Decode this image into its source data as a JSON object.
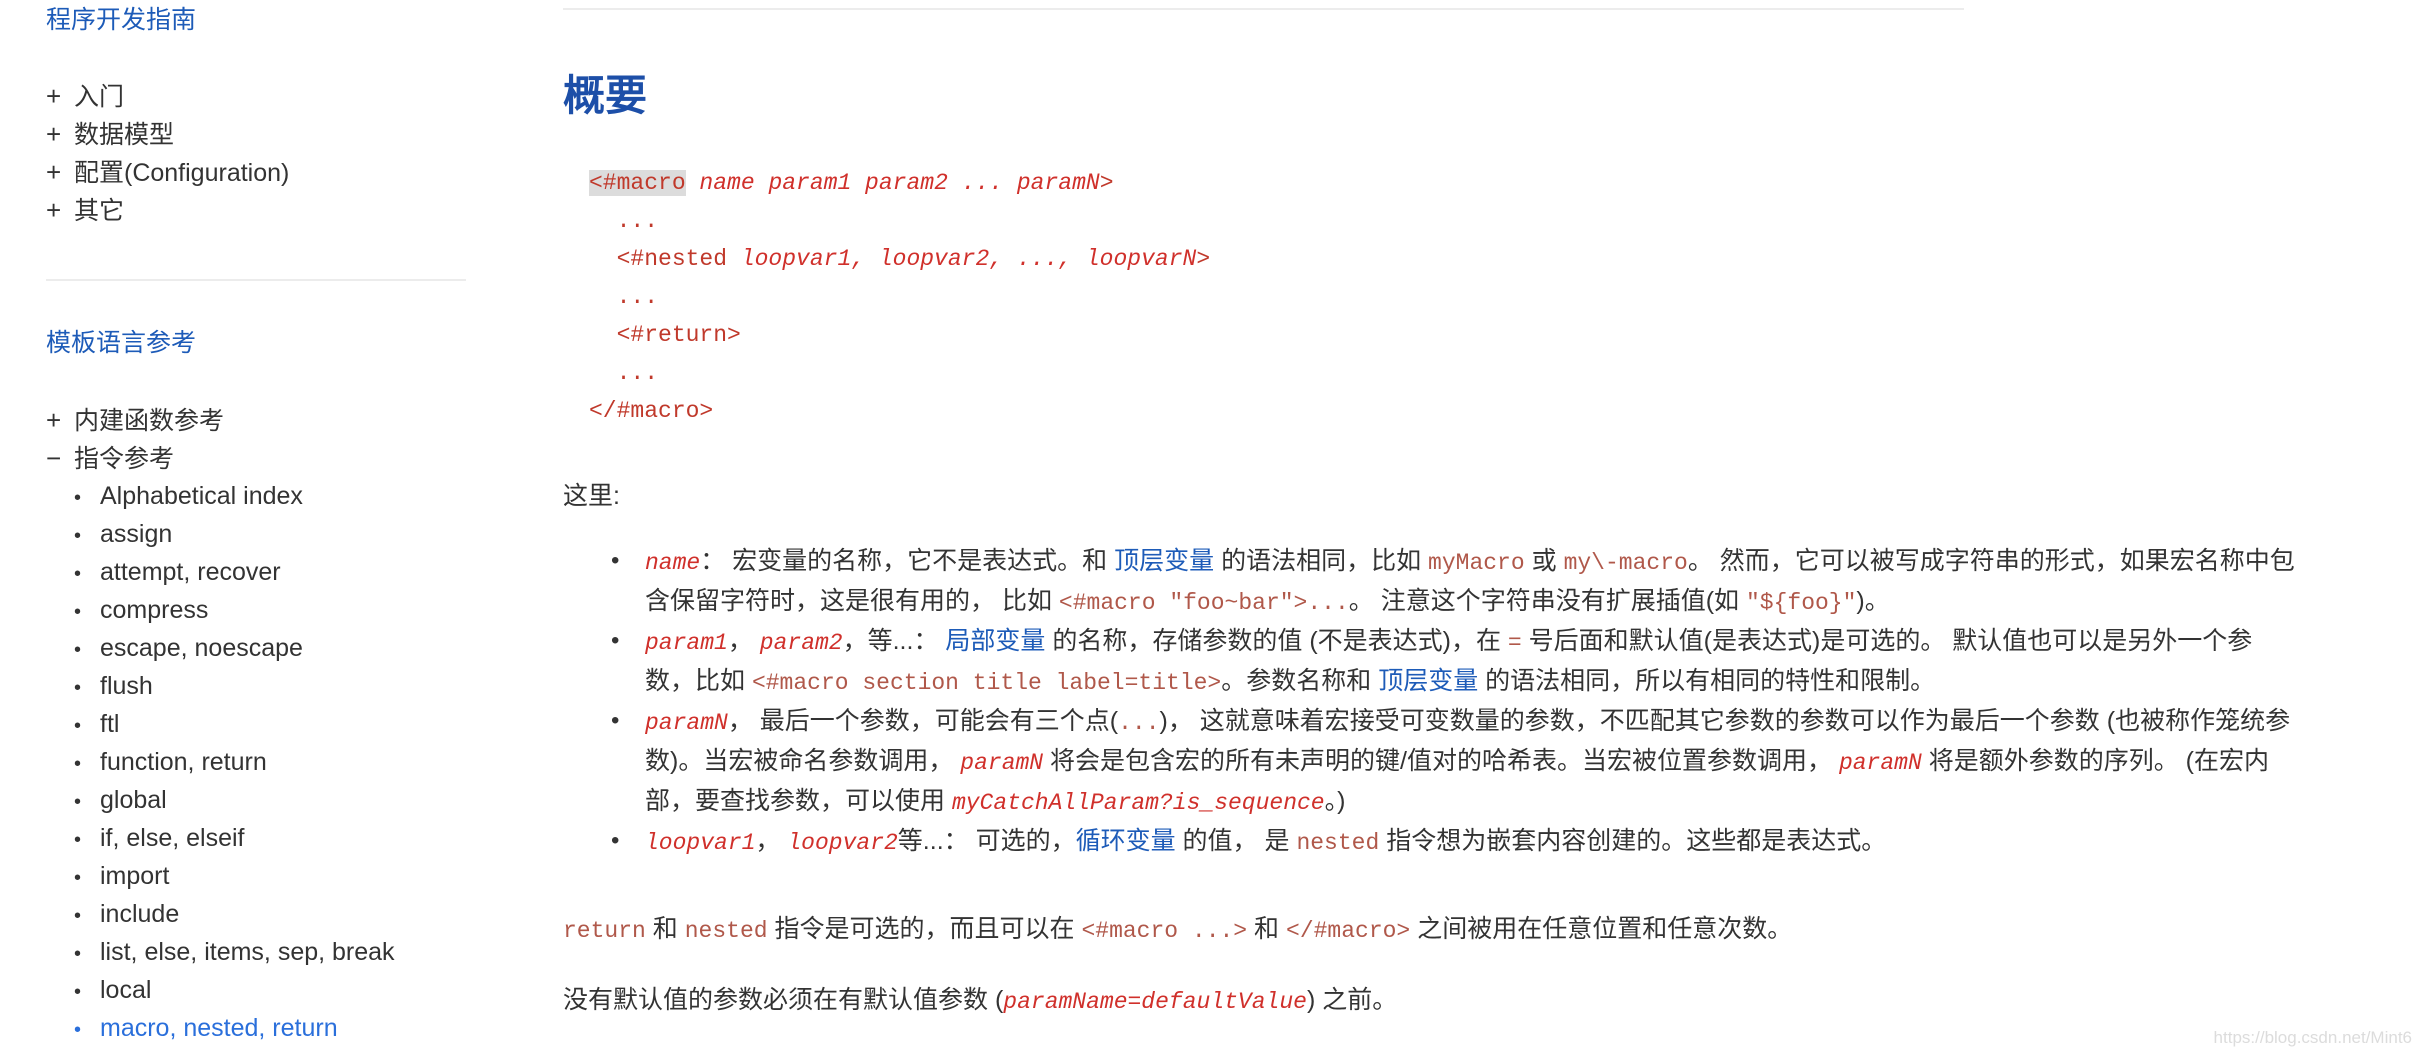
{
  "sidebar": {
    "section1_title": "程序开发指南",
    "group1": [
      {
        "toggle": "+",
        "label": "入门"
      },
      {
        "toggle": "+",
        "label": "数据模型"
      },
      {
        "toggle": "+",
        "label": "配置(Configuration)"
      },
      {
        "toggle": "+",
        "label": "其它"
      }
    ],
    "section2_title": "模板语言参考",
    "group2": [
      {
        "toggle": "+",
        "label": "内建函数参考"
      },
      {
        "toggle": "−",
        "label": "指令参考"
      }
    ],
    "directives": [
      "Alphabetical index",
      "assign",
      "attempt, recover",
      "compress",
      "escape, noescape",
      "flush",
      "ftl",
      "function, return",
      "global",
      "if, else, elseif",
      "import",
      "include",
      "list, else, items, sep, break",
      "local",
      "macro, nested, return"
    ],
    "active_directive": "macro, nested, return",
    "bullet": "•"
  },
  "main": {
    "heading": "概要",
    "code": {
      "l1_tag": "<#macro",
      "l1_rest": " name param1 param2 ... paramN",
      "l1_end": ">",
      "l2": "  ...",
      "l3_tag": "  <#nested ",
      "l3_rest": "loopvar1, loopvar2, ..., loopvarN",
      "l3_end": ">",
      "l4": "  ...",
      "l5": "  <#return>",
      "l6": "  ...",
      "l7": "</#macro>"
    },
    "here_label": "这里:",
    "params": {
      "name": {
        "code": "name",
        "t1": "： 宏变量的名称，它不是表达式。和 ",
        "link1": "顶层变量",
        "t2": " 的语法相同，比如 ",
        "c1": "myMacro",
        "t3": " 或 ",
        "c2": "my\\-macro",
        "t4": "。 然而，它可以被写成字符串的形式，如果宏名称中包含保留字符时，这是很有用的， 比如 ",
        "c3": "<#macro \"foo~bar\">...",
        "t5": "。 注意这个字符串没有扩展插值(如 ",
        "c4": "\"${foo}\"",
        "t6": ")。"
      },
      "param12": {
        "code1": "param1",
        "sep": "， ",
        "code2": "param2",
        "t1": "，等...： ",
        "link1": "局部变量",
        "t2": " 的名称，存储参数的值 (不是表达式)，在 ",
        "c1": "=",
        "t3": " 号后面和默认值(是表达式)是可选的。 默认值也可以是另外一个参数，比如 ",
        "c2": "<#macro section title label=title>",
        "t4": "。参数名称和 ",
        "link2": "顶层变量",
        "t5": " 的语法相同，所以有相同的特性和限制。"
      },
      "paramN": {
        "code1": "paramN",
        "t1": "， 最后一个参数，可能会有三个点(",
        "c1": "...",
        "t2": ")， 这就意味着宏接受可变数量的参数，不匹配其它参数的参数可以作为最后一个参数 (也被称作笼统参数)。当宏被命名参数调用， ",
        "code2": "paramN",
        "t3": " 将会是包含宏的所有未声明的键/值对的哈希表。当宏被位置参数调用， ",
        "code3": "paramN",
        "t4": " 将是额外参数的序列。 (在宏内部，要查找参数，可以使用 ",
        "c2": "myCatchAllParam?is_sequence",
        "t5": "。)"
      },
      "loopvar": {
        "code1": "loopvar1",
        "sep": "， ",
        "code2": "loopvar2",
        "t1": "等...： 可选的，",
        "link1": "循环变量",
        "t2": " 的值， 是 ",
        "c1": "nested",
        "t3": " 指令想为嵌套内容创建的。这些都是表达式。"
      }
    },
    "return_para": {
      "c1": "return",
      "t1": " 和 ",
      "c2": "nested",
      "t2": " 指令是可选的，而且可以在 ",
      "c3": "<#macro ...>",
      "t3": " 和 ",
      "c4": "</#macro>",
      "t4": " 之间被用在任意位置和任意次数。"
    },
    "default_para": {
      "t1": "没有默认值的参数必须在有默认值参数 (",
      "c1": "paramName=defaultValue",
      "t2": ") 之前。"
    }
  },
  "watermark": "https://blog.csdn.net/Mint6",
  "colors": {
    "section_title": "#1d5bb8",
    "heading": "#1d4fa8",
    "active_item": "#2a6fdb",
    "code": "#c0392b",
    "text": "#333333"
  }
}
